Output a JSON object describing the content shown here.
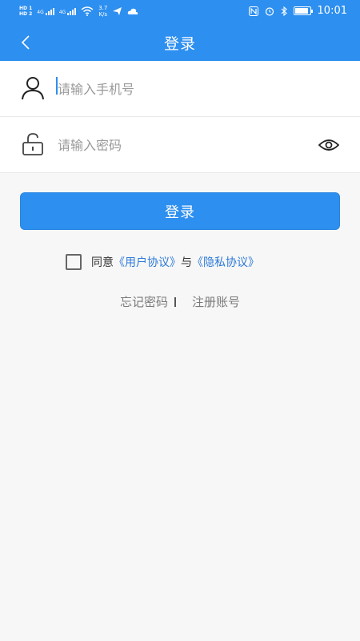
{
  "status_bar": {
    "hd1": "HD 1",
    "hd2": "HD 2",
    "sig1": "4G",
    "sig2": "4G",
    "speed_value": "3.7",
    "speed_unit": "K/s",
    "time": "10:01"
  },
  "header": {
    "title": "登录"
  },
  "form": {
    "phone_placeholder": "请输入手机号",
    "password_placeholder": "请输入密码"
  },
  "login_button": "登录",
  "agreement": {
    "prefix": "同意",
    "user_agreement": "《用户协议》",
    "conjunction": "与",
    "privacy_agreement": "《隐私协议》"
  },
  "links": {
    "forgot_password": "忘记密码",
    "register": "注册账号"
  },
  "colors": {
    "primary": "#2d8ff0",
    "link": "#2d7ad8",
    "background": "#f7f7f7"
  }
}
